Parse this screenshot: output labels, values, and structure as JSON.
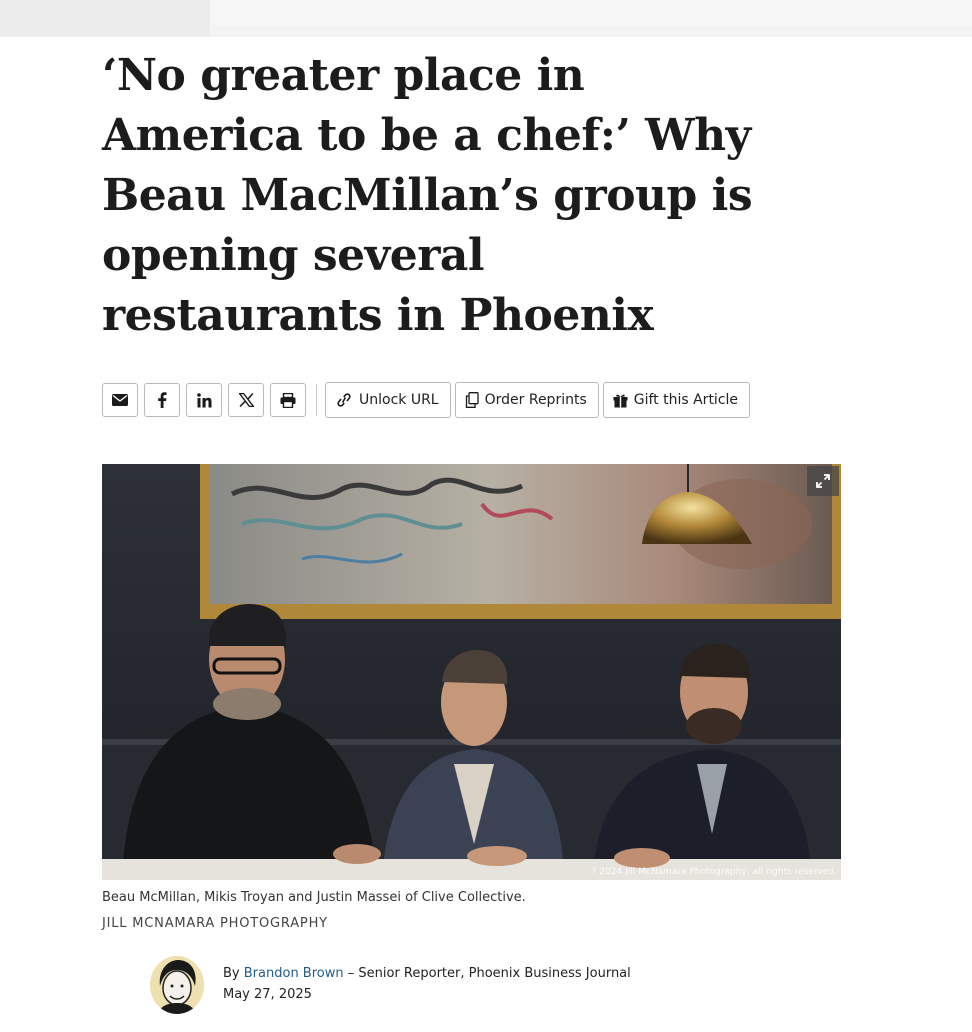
{
  "article": {
    "headline": "‘No greater place in America to be a chef:’ Why Beau MacMillan’s group is opening several restaurants in Phoenix"
  },
  "share": {
    "icons": [
      "email-icon",
      "facebook-icon",
      "linkedin-icon",
      "x-icon",
      "print-icon"
    ],
    "unlock_label": "Unlock URL",
    "reprints_label": "Order Reprints",
    "gift_label": "Gift this Article"
  },
  "photo": {
    "copyright": "? 2024 Jill McNamara Photography, all rights reserved.",
    "caption": "Beau McMillan, Mikis Troyan and Justin Massei of Clive Collective.",
    "credit": "JILL MCNAMARA PHOTOGRAPHY"
  },
  "byline": {
    "prefix": "By",
    "author": "Brandon Brown",
    "role": "– Senior Reporter, Phoenix Business Journal",
    "date": "May 27, 2025"
  },
  "colors": {
    "link": "#1f5d8a",
    "button_border": "#b9b9b9",
    "headline": "#1c1c1c"
  }
}
